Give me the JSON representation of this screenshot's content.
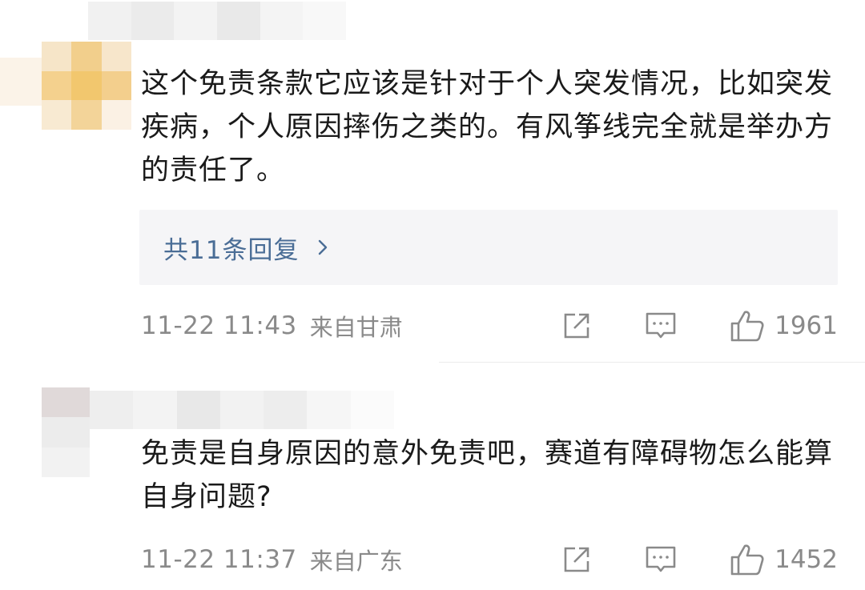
{
  "comments": [
    {
      "text": "这个免责条款它应该是针对于个人突发情况，比如突发疾病，个人原因摔伤之类的。有风筝线完全就是举办方的责任了。",
      "replies_label": "共11条回复",
      "time": "11-22 11:43",
      "location": "来自甘肃",
      "likes": "1961"
    },
    {
      "text": "免责是自身原因的意外免责吧，赛道有障碍物怎么能算自身问题?",
      "time": "11-22 11:37",
      "location": "来自广东",
      "likes": "1452"
    }
  ],
  "icons": {
    "share": "share-icon",
    "comment": "comment-icon",
    "like": "thumbs-up-icon",
    "chevron": "chevron-right-icon"
  },
  "colors": {
    "link": "#4a6d96",
    "meta": "#8a8a8a",
    "reply_bg": "#f5f5f7"
  }
}
